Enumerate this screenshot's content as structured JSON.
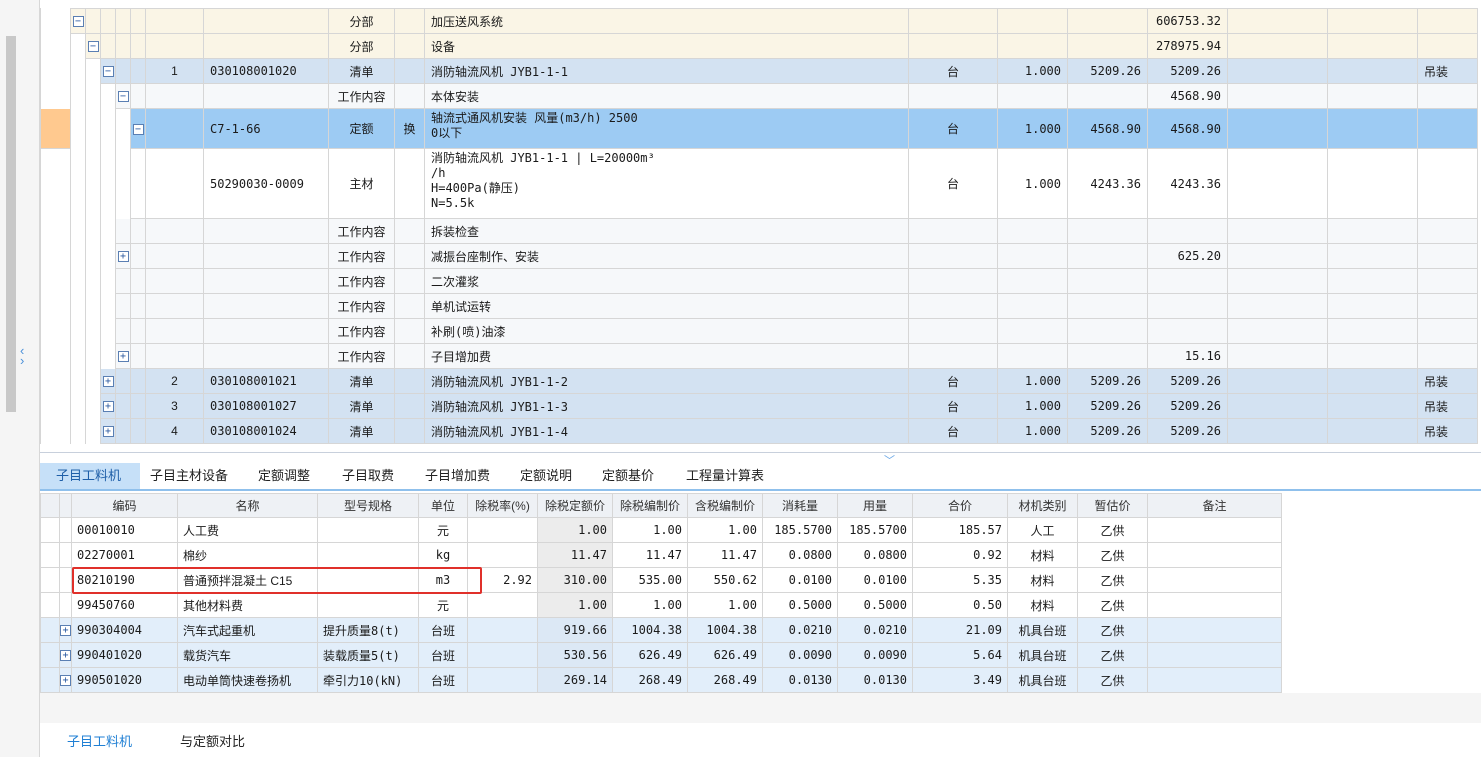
{
  "tree_rows": [
    {
      "num": "",
      "code": "",
      "type": "分部",
      "swap": "",
      "name": "加压送风系统",
      "unit": "",
      "qty": "",
      "price": "",
      "total": "606753.32",
      "remark": ""
    },
    {
      "num": "",
      "code": "",
      "type": "分部",
      "swap": "",
      "name": "设备",
      "unit": "",
      "qty": "",
      "price": "",
      "total": "278975.94",
      "remark": ""
    },
    {
      "num": "1",
      "code": "030108001020",
      "type": "清单",
      "swap": "",
      "name": "消防轴流风机 JYB1-1-1",
      "unit": "台",
      "qty": "1.000",
      "price": "5209.26",
      "total": "5209.26",
      "remark": "吊装"
    },
    {
      "num": "",
      "code": "",
      "type": "工作内容",
      "swap": "",
      "name": "本体安装",
      "unit": "",
      "qty": "",
      "price": "",
      "total": "4568.90",
      "remark": ""
    },
    {
      "num": "",
      "code": "C7-1-66",
      "type": "定额",
      "swap": "换",
      "name": "轴流式通风机安装 风量(m3/h) 2500\n0以下",
      "unit": "台",
      "qty": "1.000",
      "price": "4568.90",
      "total": "4568.90",
      "remark": ""
    },
    {
      "num": "",
      "code": "50290030-0009",
      "type": "主材",
      "swap": "",
      "name": "消防轴流风机 JYB1-1-1 | L=20000m³\n/h\nH=400Pa(静压)\nN=5.5k",
      "unit": "台",
      "qty": "1.000",
      "price": "4243.36",
      "total": "4243.36",
      "remark": ""
    },
    {
      "num": "",
      "code": "",
      "type": "工作内容",
      "swap": "",
      "name": "拆装检查",
      "unit": "",
      "qty": "",
      "price": "",
      "total": "",
      "remark": ""
    },
    {
      "num": "",
      "code": "",
      "type": "工作内容",
      "swap": "",
      "name": "减振台座制作、安装",
      "unit": "",
      "qty": "",
      "price": "",
      "total": "625.20",
      "remark": ""
    },
    {
      "num": "",
      "code": "",
      "type": "工作内容",
      "swap": "",
      "name": "二次灌浆",
      "unit": "",
      "qty": "",
      "price": "",
      "total": "",
      "remark": ""
    },
    {
      "num": "",
      "code": "",
      "type": "工作内容",
      "swap": "",
      "name": "单机试运转",
      "unit": "",
      "qty": "",
      "price": "",
      "total": "",
      "remark": ""
    },
    {
      "num": "",
      "code": "",
      "type": "工作内容",
      "swap": "",
      "name": "补刷(喷)油漆",
      "unit": "",
      "qty": "",
      "price": "",
      "total": "",
      "remark": ""
    },
    {
      "num": "",
      "code": "",
      "type": "工作内容",
      "swap": "",
      "name": "子目增加费",
      "unit": "",
      "qty": "",
      "price": "",
      "total": "15.16",
      "remark": ""
    },
    {
      "num": "2",
      "code": "030108001021",
      "type": "清单",
      "swap": "",
      "name": "消防轴流风机 JYB1-1-2",
      "unit": "台",
      "qty": "1.000",
      "price": "5209.26",
      "total": "5209.26",
      "remark": "吊装"
    },
    {
      "num": "3",
      "code": "030108001027",
      "type": "清单",
      "swap": "",
      "name": "消防轴流风机 JYB1-1-3",
      "unit": "台",
      "qty": "1.000",
      "price": "5209.26",
      "total": "5209.26",
      "remark": "吊装"
    },
    {
      "num": "4",
      "code": "030108001024",
      "type": "清单",
      "swap": "",
      "name": "消防轴流风机 JYB1-1-4",
      "unit": "台",
      "qty": "1.000",
      "price": "5209.26",
      "total": "5209.26",
      "remark": "吊装"
    }
  ],
  "tabs": [
    "子目工料机",
    "子目主材设备",
    "定额调整",
    "子目取费",
    "子目增加费",
    "定额说明",
    "定额基价",
    "工程量计算表"
  ],
  "detail_headers": [
    "编码",
    "名称",
    "型号规格",
    "单位",
    "除税率(%)",
    "除税定额价",
    "除税编制价",
    "含税编制价",
    "消耗量",
    "用量",
    "合价",
    "材机类别",
    "暂估价",
    "备注"
  ],
  "detail_rows": [
    {
      "code": "00010010",
      "name": "人工费",
      "spec": "",
      "unit": "元",
      "tax": "",
      "base": "1.00",
      "ex": "1.00",
      "inc": "1.00",
      "cons": "185.5700",
      "use": "185.5700",
      "total": "185.57",
      "cat": "人工",
      "est": "乙供",
      "remark": ""
    },
    {
      "code": "02270001",
      "name": "棉纱",
      "spec": "",
      "unit": "kg",
      "tax": "",
      "base": "11.47",
      "ex": "11.47",
      "inc": "11.47",
      "cons": "0.0800",
      "use": "0.0800",
      "total": "0.92",
      "cat": "材料",
      "est": "乙供",
      "remark": ""
    },
    {
      "code": "80210190",
      "name": "普通预拌混凝土 C15",
      "spec": "",
      "unit": "m3",
      "tax": "2.92",
      "base": "310.00",
      "ex": "535.00",
      "inc": "550.62",
      "cons": "0.0100",
      "use": "0.0100",
      "total": "5.35",
      "cat": "材料",
      "est": "乙供",
      "remark": ""
    },
    {
      "code": "99450760",
      "name": "其他材料费",
      "spec": "",
      "unit": "元",
      "tax": "",
      "base": "1.00",
      "ex": "1.00",
      "inc": "1.00",
      "cons": "0.5000",
      "use": "0.5000",
      "total": "0.50",
      "cat": "材料",
      "est": "乙供",
      "remark": ""
    },
    {
      "code": "990304004",
      "name": "汽车式起重机",
      "spec": "提升质量8(t)",
      "unit": "台班",
      "tax": "",
      "base": "919.66",
      "ex": "1004.38",
      "inc": "1004.38",
      "cons": "0.0210",
      "use": "0.0210",
      "total": "21.09",
      "cat": "机具台班",
      "est": "乙供",
      "remark": ""
    },
    {
      "code": "990401020",
      "name": "载货汽车",
      "spec": "装载质量5(t)",
      "unit": "台班",
      "tax": "",
      "base": "530.56",
      "ex": "626.49",
      "inc": "626.49",
      "cons": "0.0090",
      "use": "0.0090",
      "total": "5.64",
      "cat": "机具台班",
      "est": "乙供",
      "remark": ""
    },
    {
      "code": "990501020",
      "name": "电动单筒快速卷扬机",
      "spec": "牵引力10(kN)",
      "unit": "台班",
      "tax": "",
      "base": "269.14",
      "ex": "268.49",
      "inc": "268.49",
      "cons": "0.0130",
      "use": "0.0130",
      "total": "3.49",
      "cat": "机具台班",
      "est": "乙供",
      "remark": ""
    }
  ],
  "bottom_tabs": [
    "子目工料机",
    "与定额对比"
  ],
  "colors": {
    "highlight_box": "#e0302a",
    "active_tab": "#c6e0f8",
    "quota_row": "#9dcbf3",
    "list_row": "#d3e2f2"
  }
}
